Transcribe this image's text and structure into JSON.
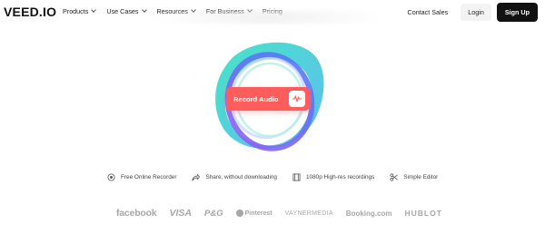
{
  "nav": {
    "logo": "VEED.IO",
    "menu": [
      {
        "label": "Products"
      },
      {
        "label": "Use Cases"
      },
      {
        "label": "Resources"
      },
      {
        "label": "For Business"
      },
      {
        "label": "Pricing"
      }
    ],
    "contact": "Contact Sales",
    "login": "Login",
    "signup": "Sign Up"
  },
  "hero": {
    "record_label": "Record Audio",
    "record_icon": "waveform-icon",
    "colors": {
      "button": "#ff5c5c",
      "teal": "#3ee3c3",
      "blue": "#4e7cf6",
      "purple": "#8f5cf2"
    }
  },
  "features": [
    {
      "icon": "recorder-icon",
      "label": "Free Online Recorder"
    },
    {
      "icon": "share-icon",
      "label": "Share, without downloading"
    },
    {
      "icon": "film-icon",
      "label": "1080p High-res recordings"
    },
    {
      "icon": "scissors-icon",
      "label": "Simple Editor"
    }
  ],
  "logos": {
    "facebook": "facebook",
    "visa": "VISA",
    "pg": "P&G",
    "pinterest": "Pinterest",
    "vayner": "VAYNERMEDIA",
    "booking": "Booking.com",
    "hublot": "HUBLOT"
  }
}
